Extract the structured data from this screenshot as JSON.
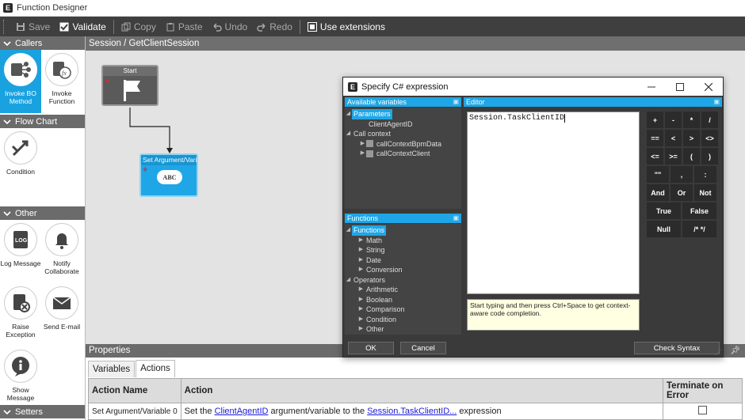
{
  "window": {
    "title": "Function Designer"
  },
  "toolbar": {
    "save": "Save",
    "validate": "Validate",
    "copy": "Copy",
    "paste": "Paste",
    "undo": "Undo",
    "redo": "Redo",
    "use_extensions": "Use extensions"
  },
  "sidebar": {
    "callers": {
      "title": "Callers",
      "items": [
        {
          "label": "Invoke BO Method",
          "icon": "bo-method-icon"
        },
        {
          "label": "Invoke Function",
          "icon": "function-icon"
        }
      ]
    },
    "flow_chart": {
      "title": "Flow Chart",
      "items": [
        {
          "label": "Condition",
          "icon": "condition-icon"
        }
      ]
    },
    "other": {
      "title": "Other",
      "items": [
        {
          "label": "Log Message",
          "icon": "log-icon"
        },
        {
          "label": "Notify Collaborate",
          "icon": "bell-icon"
        },
        {
          "label": "Raise Exception",
          "icon": "exception-icon"
        },
        {
          "label": "Send E-mail",
          "icon": "mail-icon"
        },
        {
          "label": "Show Message",
          "icon": "info-icon"
        }
      ]
    },
    "setters": {
      "title": "Setters"
    }
  },
  "canvas": {
    "breadcrumb": "Session / GetClientSession",
    "nodes": {
      "start": "Start",
      "set": "Set Argument/Vari",
      "set_badge": "ABC"
    }
  },
  "properties": {
    "title": "Properties",
    "tabs": [
      "Variables",
      "Actions"
    ],
    "active_tab": "Actions",
    "columns": [
      "Action Name",
      "Action",
      "Terminate on Error"
    ],
    "row": {
      "name": "Set Argument/Variable 0",
      "pre": "Set the",
      "arg_link": "ClientAgentID",
      "mid": "argument/variable to the",
      "expr_link": "Session.TaskClientID...",
      "post": "expression"
    }
  },
  "dialog": {
    "title": "Specify C# expression",
    "available_vars": {
      "title": "Available variables",
      "parameters": "Parameters",
      "param_item": "ClientAgentID",
      "call_context": "Call context",
      "cc_items": [
        "callContextBpmData",
        "callContextClient"
      ]
    },
    "functions": {
      "title": "Functions",
      "root": "Functions",
      "items": [
        "Math",
        "String",
        "Date",
        "Conversion"
      ],
      "operators": "Operators",
      "op_items": [
        "Arithmetic",
        "Boolean",
        "Comparison",
        "Condition",
        "Other"
      ]
    },
    "editor": {
      "title": "Editor",
      "content": "Session.TaskClientID",
      "hint": "Start typing and then press Ctrl+Space to get context-aware code completion."
    },
    "keypad": {
      "row1": [
        "+",
        "-",
        "*",
        "/"
      ],
      "row2": [
        "==",
        "<",
        ">",
        "<>"
      ],
      "row3": [
        "<=",
        ">=",
        "(",
        ")"
      ],
      "row4": [
        "\"\"",
        ",",
        ":"
      ],
      "row5": [
        "And",
        "Or",
        "Not"
      ],
      "row6": [
        "True",
        "False"
      ],
      "row7": [
        "Null",
        "/* */"
      ]
    },
    "buttons": {
      "ok": "OK",
      "cancel": "Cancel",
      "check_syntax": "Check Syntax"
    }
  },
  "colors": {
    "accent": "#1fa6e6",
    "toolbar": "#3f3f3f",
    "canvas": "#e3e3e3"
  }
}
